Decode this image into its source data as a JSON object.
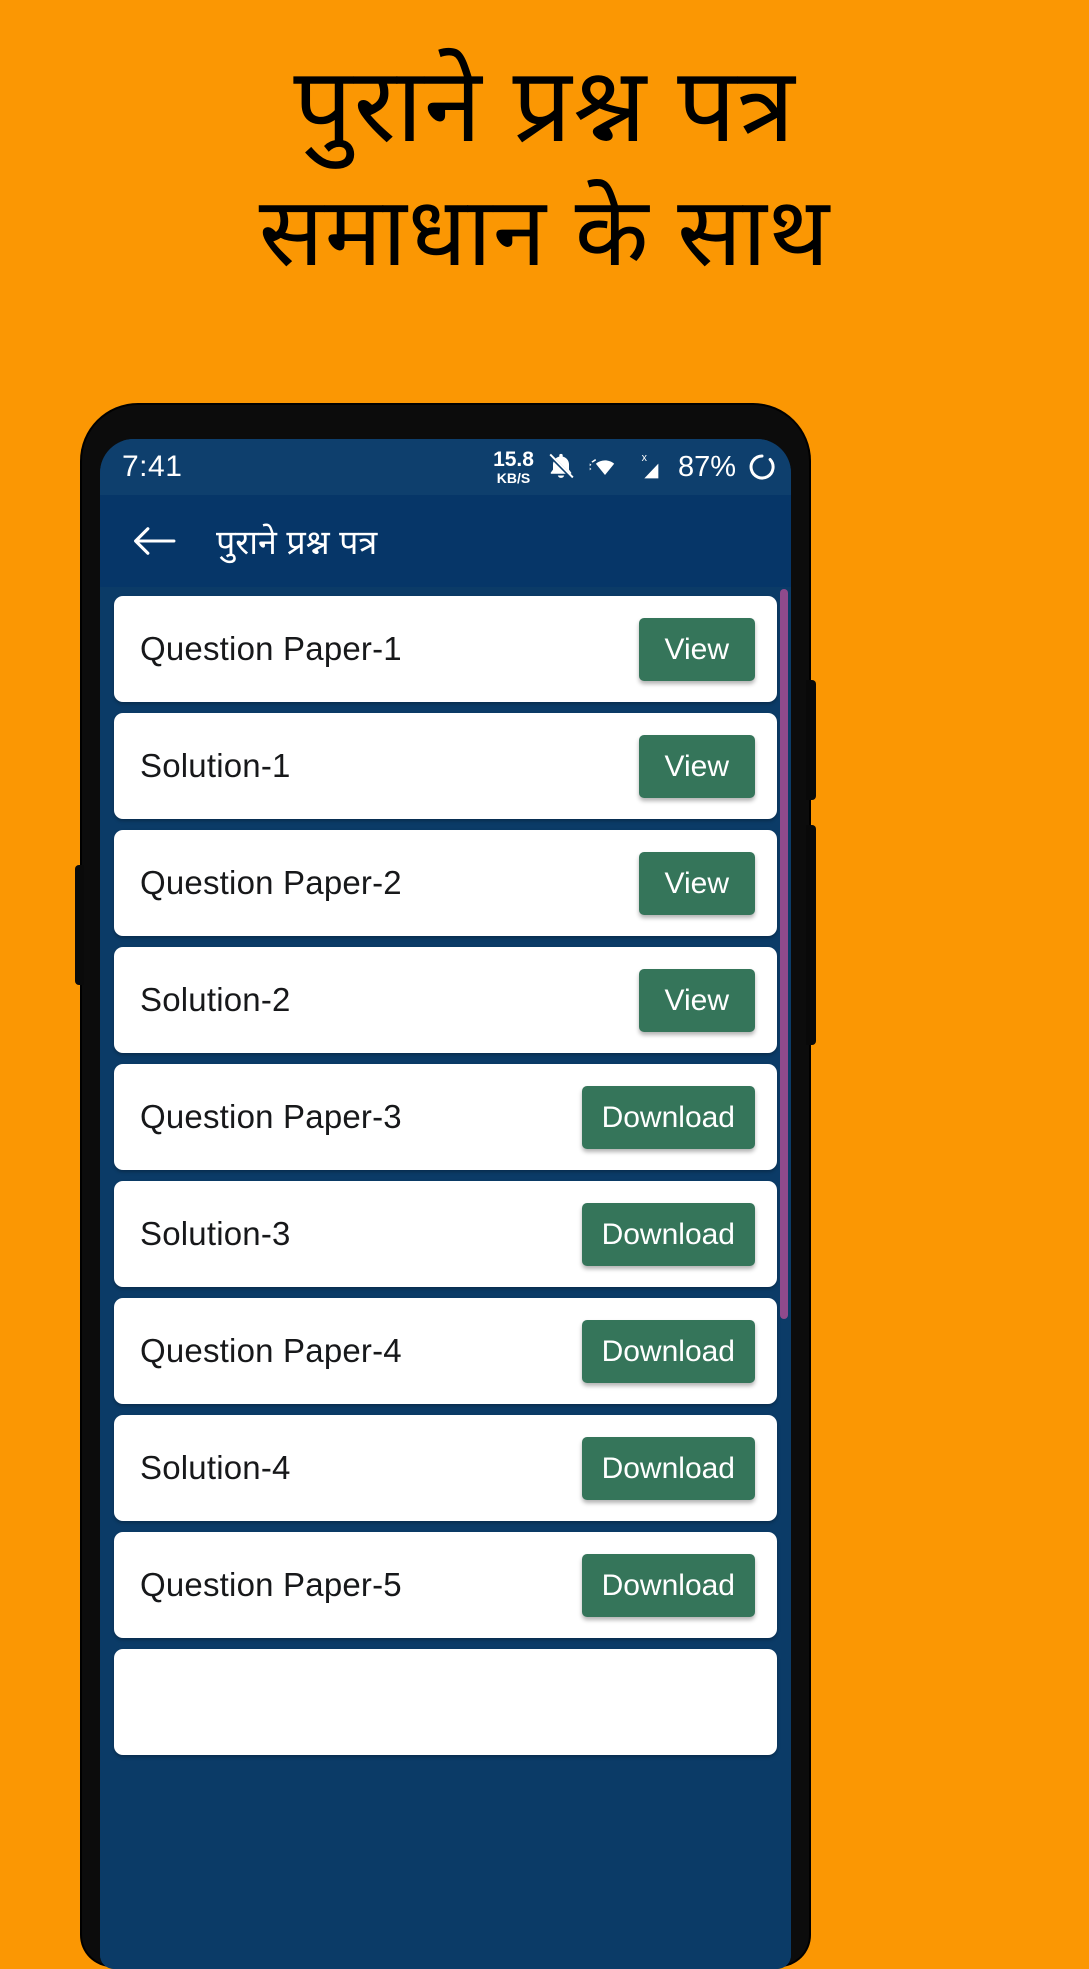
{
  "promo": {
    "line1": "पुराने प्रश्न पत्र",
    "line2": "समाधान के साथ"
  },
  "colors": {
    "background": "#FB9703",
    "appbar": "#063668",
    "statusbar": "#0E3F6D",
    "list_background": "#0B3B67",
    "card": "#FFFFFF",
    "action_button": "#35755A",
    "scrollbar": "#8F4A8C"
  },
  "statusbar": {
    "clock": "7:41",
    "net_speed_value": "15.8",
    "net_speed_unit": "KB/S",
    "mute_icon": "bell-muted-icon",
    "wifi_icon": "wifi-icon",
    "signal_icon": "signal-no-sim-icon",
    "battery_percent": "87%",
    "battery_icon": "battery-circle-icon"
  },
  "appbar": {
    "back_icon": "back-arrow-icon",
    "title": "पुराने प्रश्न पत्र"
  },
  "list": {
    "items": [
      {
        "label": "Question Paper-1",
        "action": "View"
      },
      {
        "label": "Solution-1",
        "action": "View"
      },
      {
        "label": "Question Paper-2",
        "action": "View"
      },
      {
        "label": "Solution-2",
        "action": "View"
      },
      {
        "label": "Question Paper-3",
        "action": "Download"
      },
      {
        "label": "Solution-3",
        "action": "Download"
      },
      {
        "label": "Question Paper-4",
        "action": "Download"
      },
      {
        "label": "Solution-4",
        "action": "Download"
      },
      {
        "label": "Question Paper-5",
        "action": "Download"
      },
      {
        "label": "",
        "action": ""
      }
    ]
  }
}
